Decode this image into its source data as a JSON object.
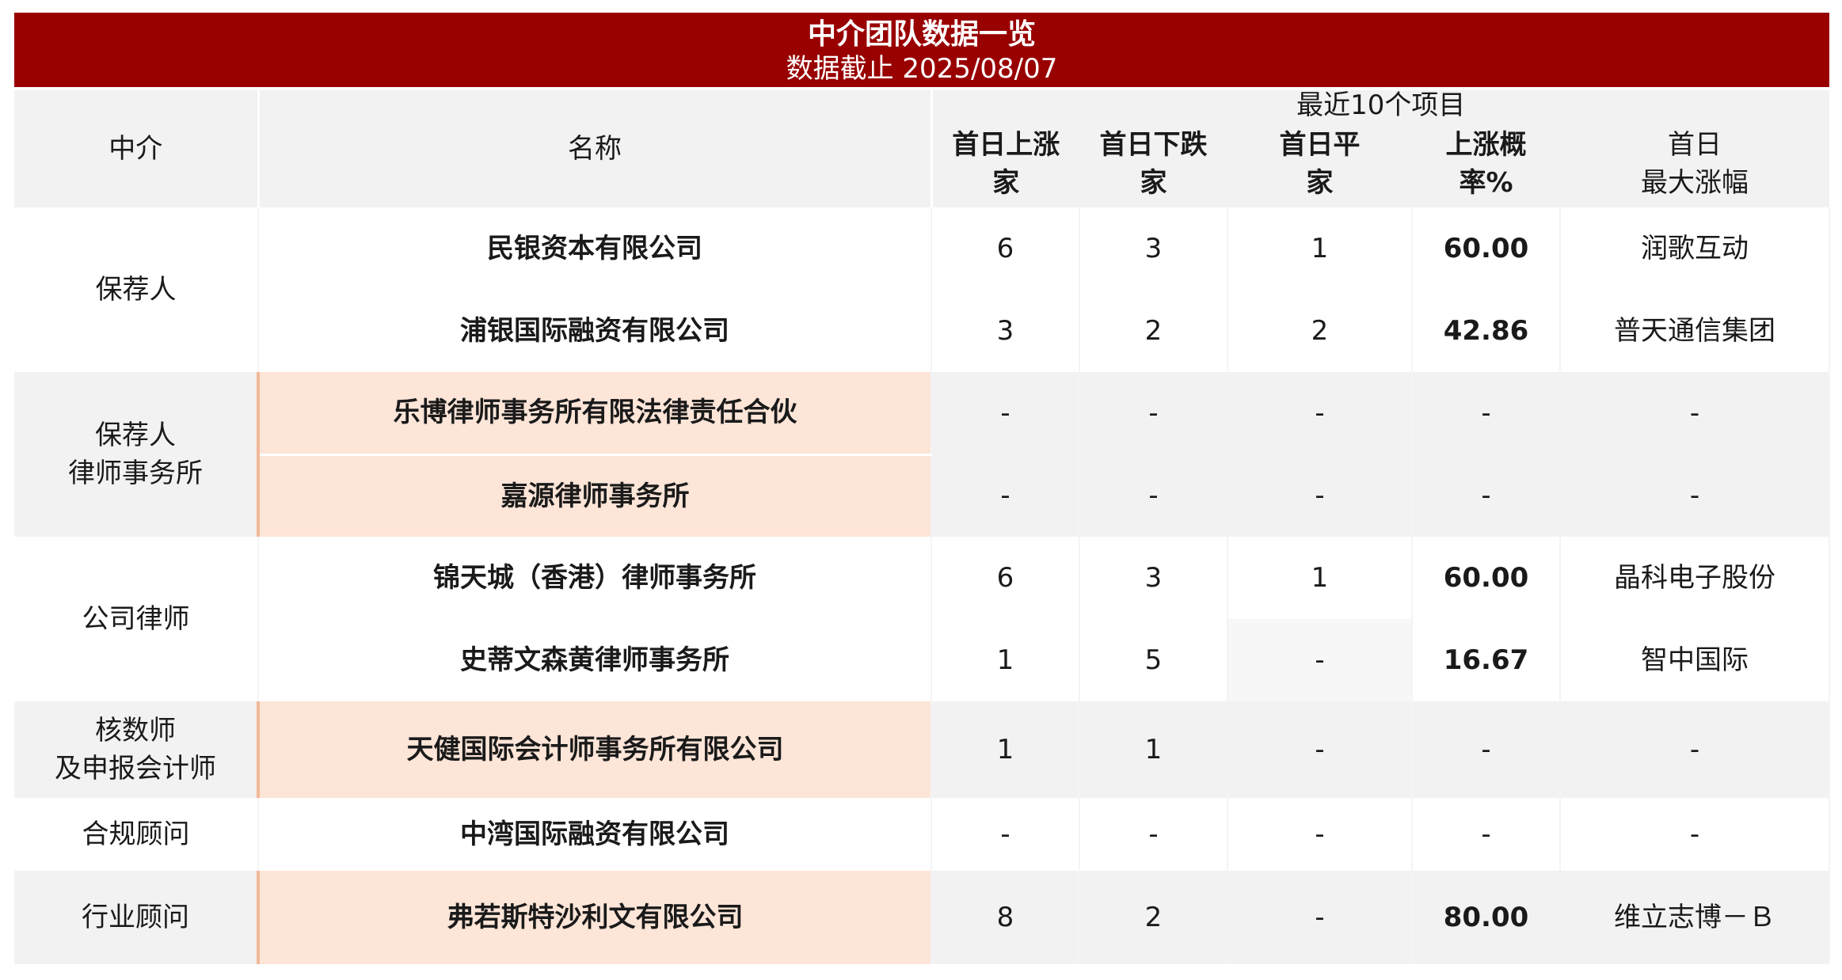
{
  "title": "中介团队数据一览",
  "subtitle": "数据截止 2025/08/07",
  "header": {
    "col_intermediary": "中介",
    "col_name": "名称",
    "group_label": "最近10个项目",
    "col_up": "首日上涨家",
    "col_down": "首日下跌家",
    "col_flat": "首日平家",
    "col_rate": "上涨概率%",
    "col_max_line1": "首日",
    "col_max_line2": "最大涨幅"
  },
  "rows": [
    {
      "name": "民银资本有限公司",
      "up": "6",
      "down": "3",
      "flat": "1",
      "rate": "60.00",
      "max": "润歌互动"
    },
    {
      "name": "浦银国际融资有限公司",
      "up": "3",
      "down": "2",
      "flat": "2",
      "rate": "42.86",
      "max": "普天通信集团"
    },
    {
      "name": "乐博律师事务所有限法律责任合伙",
      "up": "-",
      "down": "-",
      "flat": "-",
      "rate": "-",
      "max": "-"
    },
    {
      "name": "嘉源律师事务所",
      "up": "-",
      "down": "-",
      "flat": "-",
      "rate": "-",
      "max": "-"
    },
    {
      "name": "锦天城（香港）律师事务所",
      "up": "6",
      "down": "3",
      "flat": "1",
      "rate": "60.00",
      "max": "晶科电子股份"
    },
    {
      "name": "史蒂文森黄律师事务所",
      "up": "1",
      "down": "5",
      "flat": "-",
      "rate": "16.67",
      "max": "智中国际"
    },
    {
      "name": "天健国际会计师事务所有限公司",
      "up": "1",
      "down": "1",
      "flat": "-",
      "rate": "-",
      "max": "-"
    },
    {
      "name": "中湾国际融资有限公司",
      "up": "-",
      "down": "-",
      "flat": "-",
      "rate": "-",
      "max": "-"
    },
    {
      "name": "弗若斯特沙利文有限公司",
      "up": "8",
      "down": "2",
      "flat": "-",
      "rate": "80.00",
      "max": "维立志博－Ｂ"
    }
  ],
  "groups": {
    "sponsor": "保荐人",
    "sponsor_lawyer_line1": "保荐人",
    "sponsor_lawyer_line2": "律师事务所",
    "company_lawyer": "公司律师",
    "auditor_line1": "核数师",
    "auditor_line2": "及申报会计师",
    "compliance": "合规顾问",
    "industry": "行业顾问"
  },
  "colors": {
    "title_bg": "#990000",
    "header_bg": "#f2f2f2",
    "highlight_bg": "#fde5d8",
    "highlight_border": "#f2b899"
  }
}
